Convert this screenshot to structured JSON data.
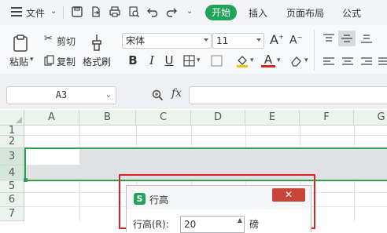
{
  "menubar": {
    "file_label": "文件",
    "tabs": [
      {
        "label": "开始"
      },
      {
        "label": "插入"
      },
      {
        "label": "页面布局"
      },
      {
        "label": "公式"
      }
    ]
  },
  "ribbon": {
    "paste_label": "粘贴",
    "cut_label": "剪切",
    "copy_label": "复制",
    "format_painter_label": "格式刷",
    "font_name": "宋体",
    "font_size": "11",
    "bold": "B",
    "italic": "I",
    "underline": "U",
    "grow_font": "A",
    "shrink_font": "A",
    "font_color": "A"
  },
  "formula_bar": {
    "name_box": "A3",
    "fx_label": "fx"
  },
  "grid": {
    "columns": [
      "A",
      "B",
      "C",
      "D",
      "E",
      "F",
      "G"
    ],
    "rows": [
      "1",
      "2",
      "3",
      "4",
      "5",
      "6",
      "7"
    ]
  },
  "dialog": {
    "title": "行高",
    "close_label": "✕",
    "field_label": "行高(R):",
    "value": "20",
    "unit": "磅"
  },
  "colors": {
    "accent": "#1fa55a",
    "selection_border": "#2e9e4f",
    "highlight_red": "#d9261c"
  }
}
